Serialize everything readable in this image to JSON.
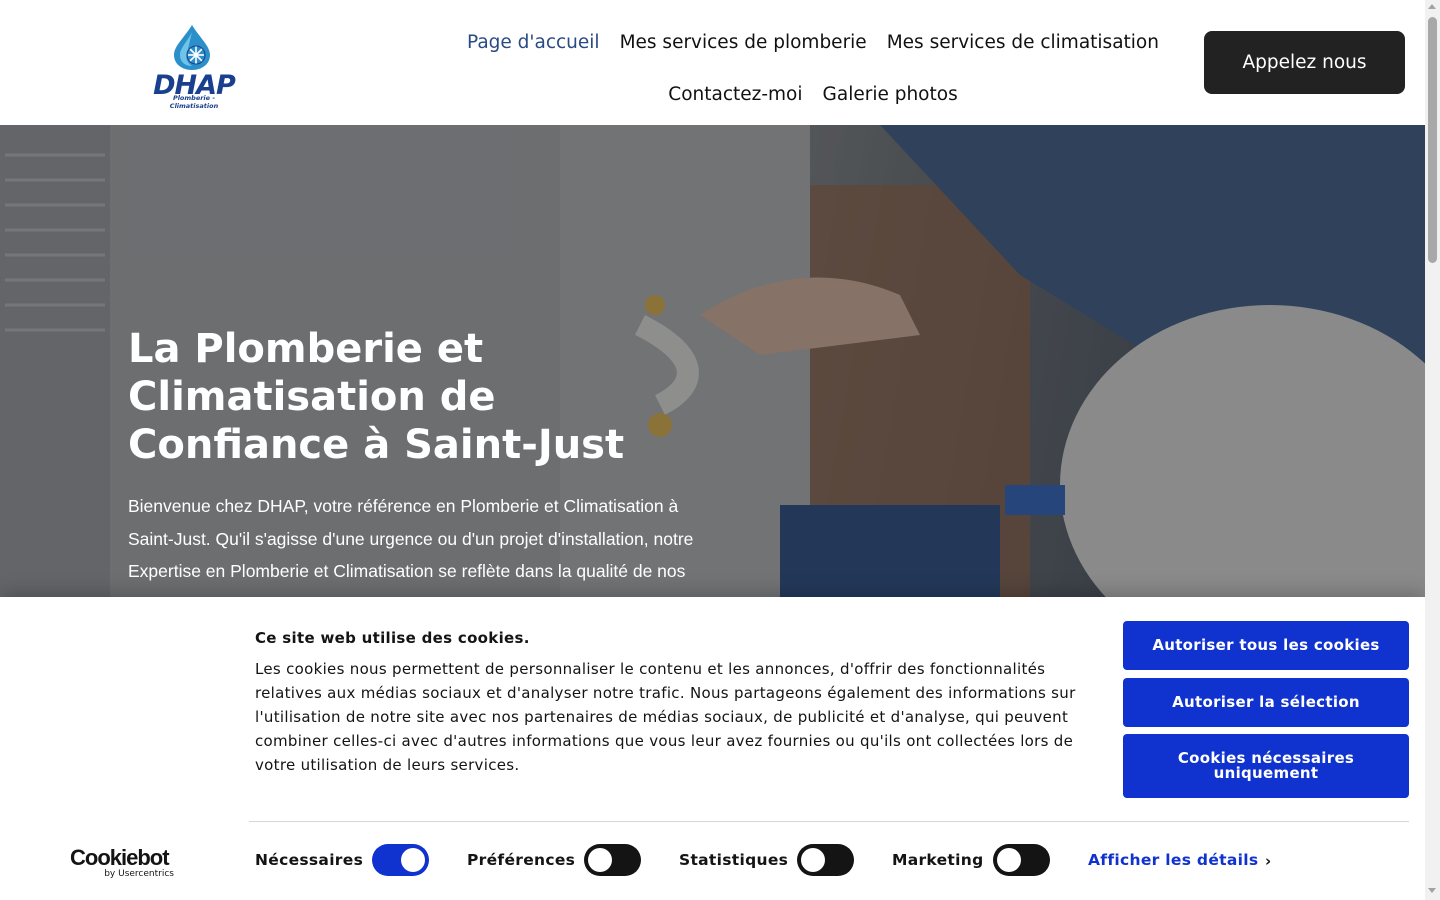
{
  "header": {
    "logo": {
      "name": "DHAP",
      "tagline": "Plomberie - Climatisation"
    },
    "nav": [
      {
        "label": "Page d'accueil",
        "active": true
      },
      {
        "label": "Mes services de plomberie"
      },
      {
        "label": "Mes services de climatisation"
      },
      {
        "label": "Contactez-moi"
      },
      {
        "label": "Galerie photos"
      }
    ],
    "call_button": "Appelez nous"
  },
  "hero": {
    "title": "La Plomberie et Climatisation de Confiance à Saint-Just",
    "text": "Bienvenue chez DHAP, votre référence en Plomberie et Climatisation à Saint-Just. Qu'il s'agisse d'une urgence ou d'un projet d'installation, notre Expertise en Plomberie et Climatisation se reflète dans la qualité de nos services adaptés à vos besoins spécifiques."
  },
  "cookie_banner": {
    "title": "Ce site web utilise des cookies.",
    "text": "Les cookies nous permettent de personnaliser le contenu et les annonces, d'offrir des fonctionnalités relatives aux médias sociaux et d'analyser notre trafic. Nous partageons également des informations sur l'utilisation de notre site avec nos partenaires de médias sociaux, de publicité et d'analyse, qui peuvent combiner celles-ci avec d'autres informations que vous leur avez fournies ou qu'ils ont collectées lors de votre utilisation de leurs services.",
    "buttons": {
      "allow_all": "Autoriser tous les cookies",
      "allow_selection": "Autoriser la sélection",
      "necessary_only": "Cookies nécessaires uniquement"
    },
    "brand": {
      "name": "Cookiebot",
      "by": "by Usercentrics"
    },
    "toggles": [
      {
        "label": "Nécessaires",
        "on": true
      },
      {
        "label": "Préférences",
        "on": false
      },
      {
        "label": "Statistiques",
        "on": false
      },
      {
        "label": "Marketing",
        "on": false
      }
    ],
    "details_link": "Afficher les détails"
  },
  "colors": {
    "accent": "#1032cf",
    "nav_active": "#2a4a86",
    "logo_blue": "#1a3f8f",
    "dark_button": "#222222"
  }
}
